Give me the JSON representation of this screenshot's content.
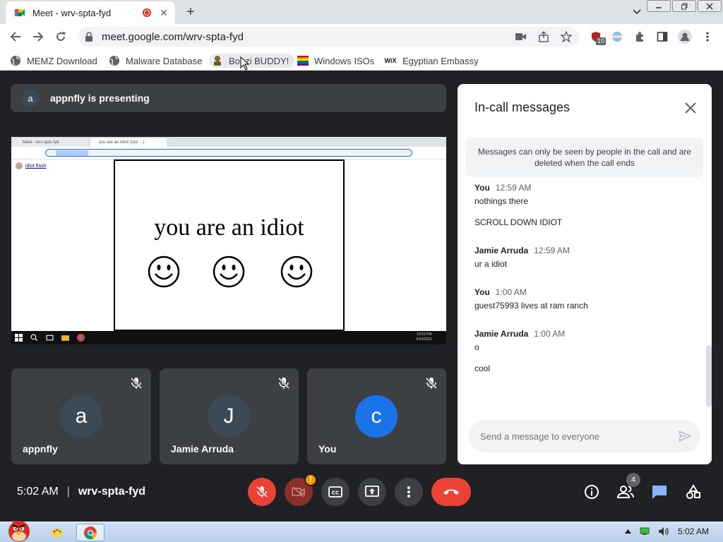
{
  "browser": {
    "tab_title": "Meet - wrv-spta-fyd",
    "url": "meet.google.com/wrv-spta-fyd",
    "extension_badge": "10",
    "bookmarks": [
      {
        "label": "MEMZ Download",
        "icon": "globe-icon"
      },
      {
        "label": "Malware Database",
        "icon": "globe-icon"
      },
      {
        "label": "Bonzi BUDDY!",
        "icon": "bonzi-icon"
      },
      {
        "label": "Windows ISOs",
        "icon": "rainbow-flag-icon"
      },
      {
        "label": "Egyptian Embassy",
        "icon": "wix-icon"
      }
    ]
  },
  "meet": {
    "presenter_initial": "a",
    "presenting_text": "appnfly is presenting",
    "shared_screen": {
      "main_text": "you are an idiot",
      "mini_tab_1": "Meet - wrv-spta-fyd",
      "mini_tab_2": "you are an idiot! (lost ...)",
      "mini_link": "idiot flash",
      "mini_clock_time": "10:52 PM",
      "mini_clock_date": "6/24/2021"
    },
    "participants": [
      {
        "initial": "a",
        "name": "appnfly",
        "color": "#3c4a55"
      },
      {
        "initial": "J",
        "name": "Jamie Arruda",
        "color": "#3c4a55"
      },
      {
        "initial": "c",
        "name": "You",
        "color": "#1a73e8"
      }
    ],
    "chat": {
      "title": "In-call messages",
      "notice": "Messages can only be seen by people in the call and are deleted when the call ends",
      "messages": [
        {
          "sender": "You",
          "time": "12:59 AM",
          "lines": [
            "nothings there",
            "SCROLL DOWN IDIOT"
          ]
        },
        {
          "sender": "Jamie Arruda",
          "time": "12:59 AM",
          "lines": [
            "ur a idiot"
          ]
        },
        {
          "sender": "You",
          "time": "1:00 AM",
          "lines": [
            "guest75993 lives at ram ranch"
          ]
        },
        {
          "sender": "Jamie Arruda",
          "time": "1:00 AM",
          "lines": [
            "o",
            "cool"
          ]
        }
      ],
      "input_placeholder": "Send a message to everyone"
    },
    "bottom": {
      "time": "5:02 AM",
      "separator": "|",
      "meeting_code": "wrv-spta-fyd",
      "camera_warning": "!",
      "people_count": "4"
    }
  },
  "taskbar": {
    "clock": "5:02 AM"
  },
  "colors": {
    "meet_bg": "#202124",
    "tile_bg": "#3c4043",
    "red": "#ea4335",
    "blue_avatar": "#1a73e8"
  }
}
